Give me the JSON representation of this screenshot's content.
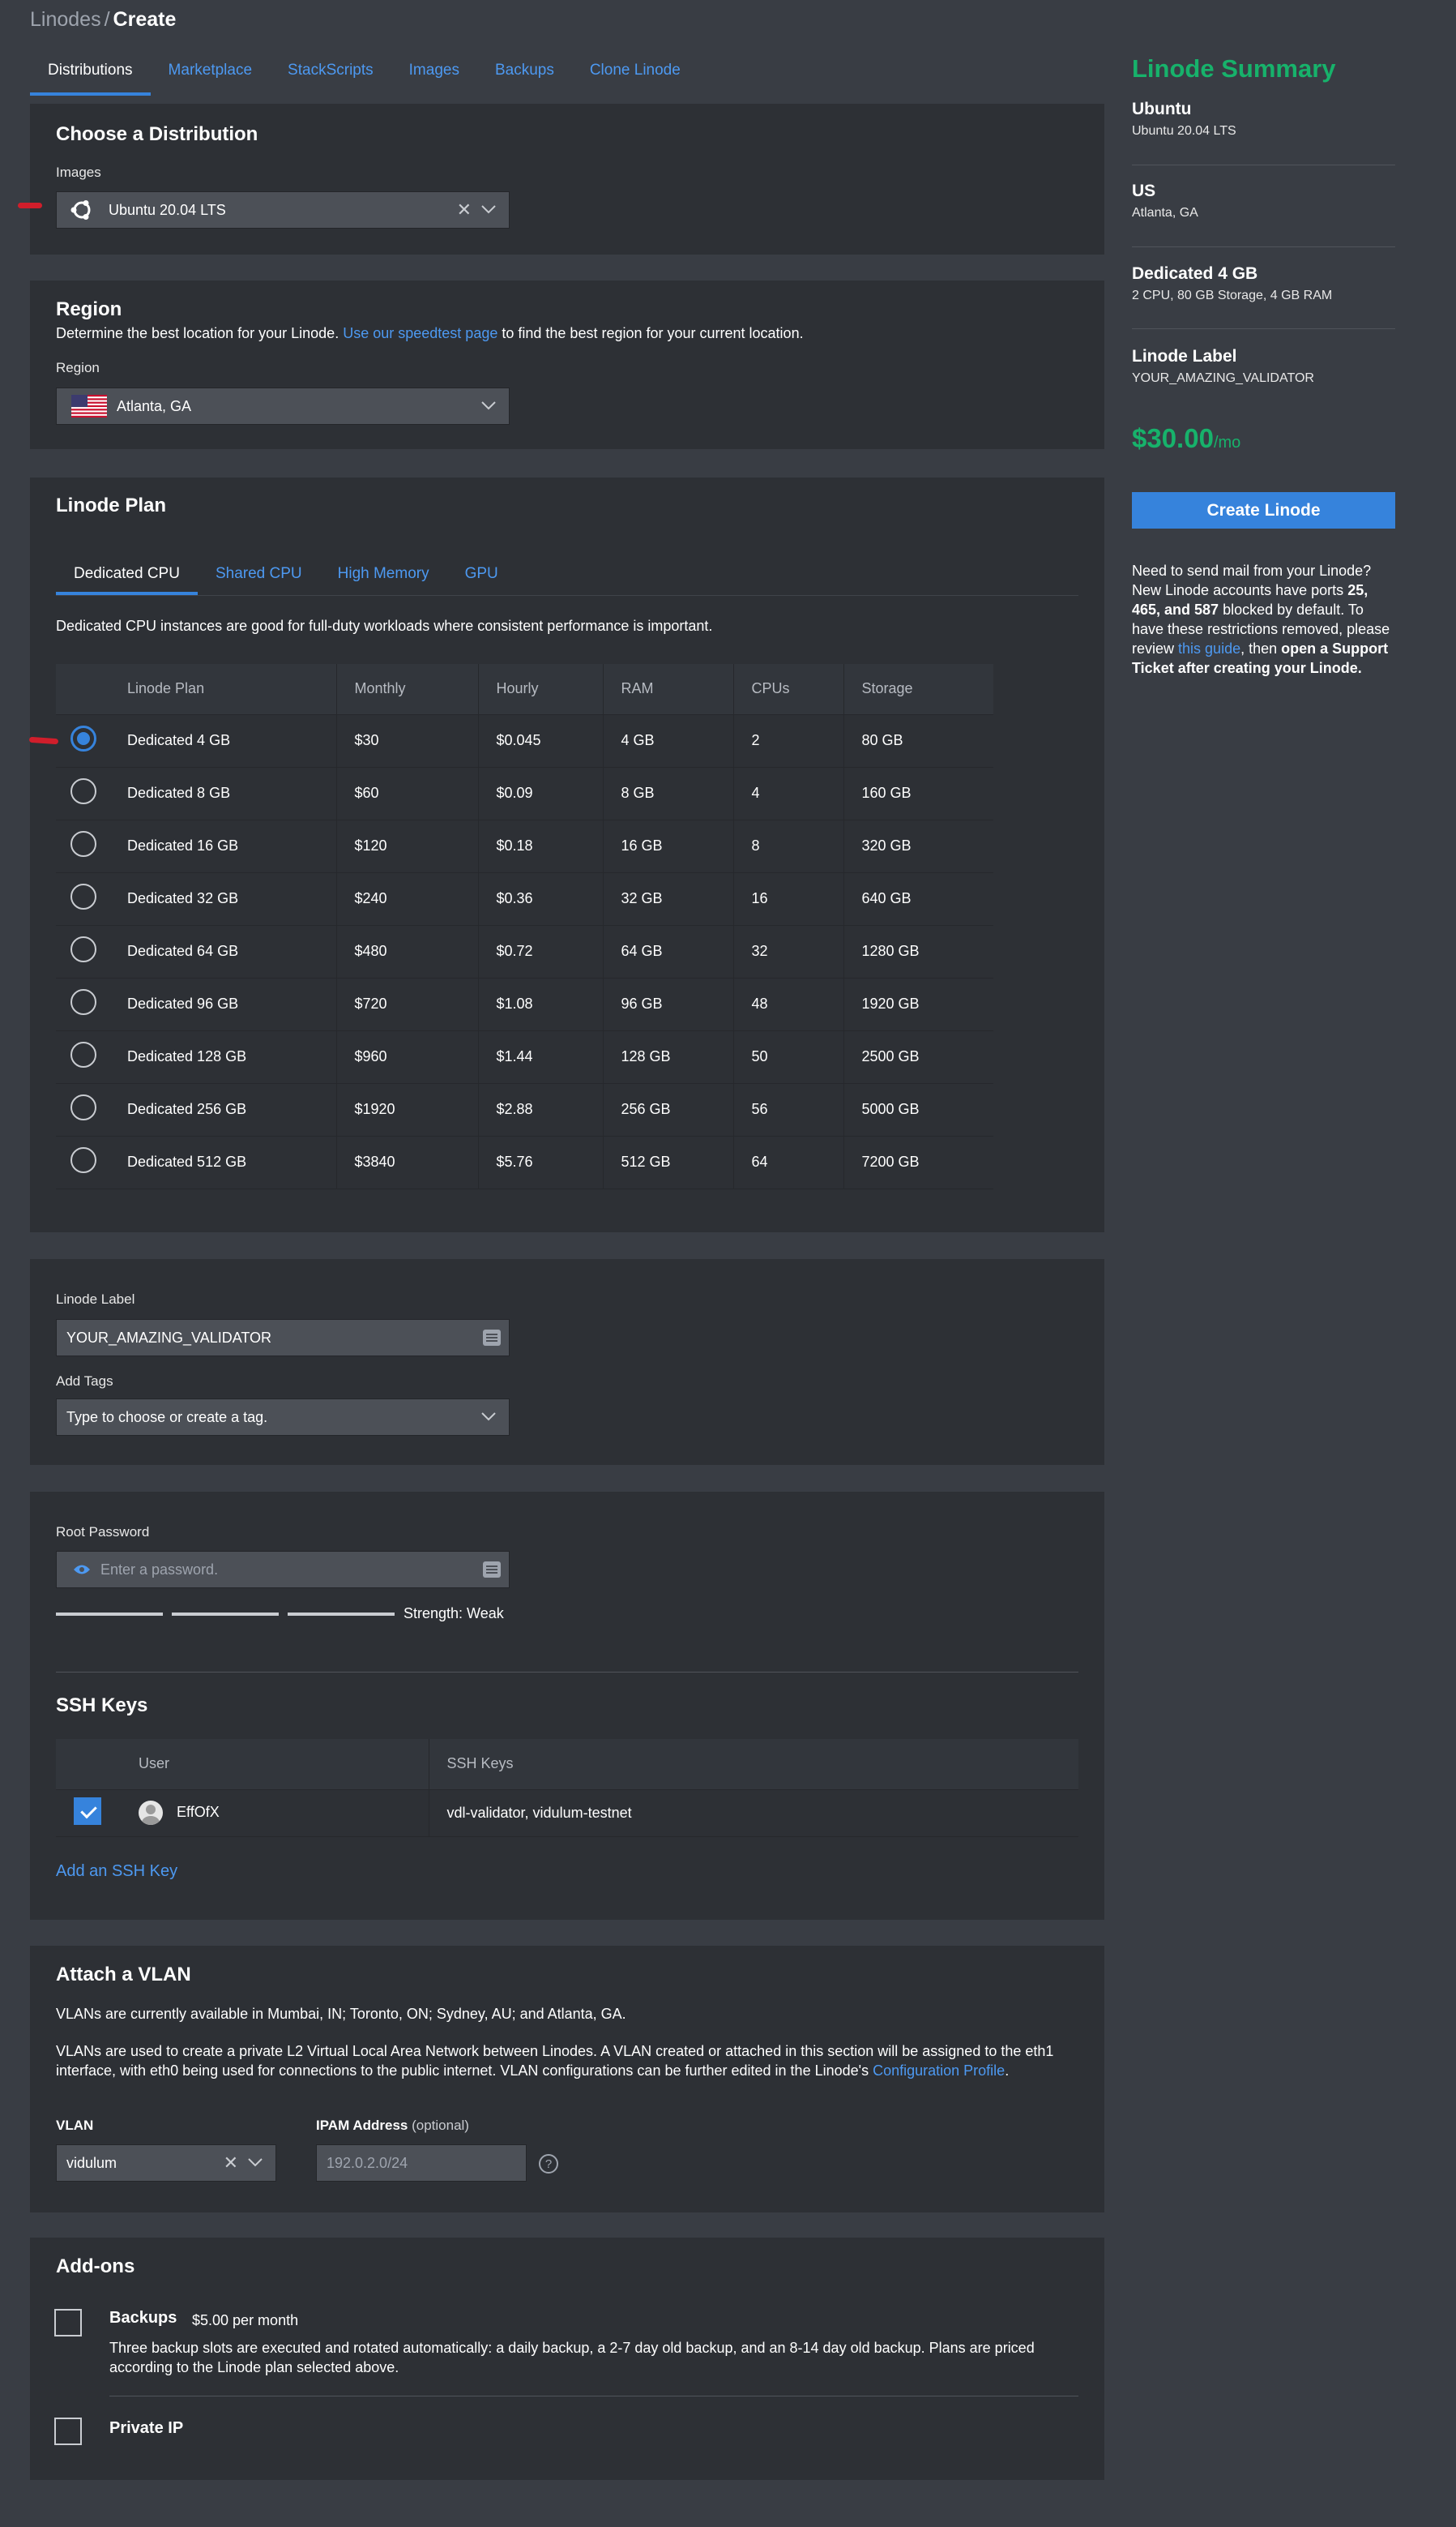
{
  "breadcrumb": {
    "parent": "Linodes",
    "separator": "/",
    "current": "Create"
  },
  "tabs": [
    "Distributions",
    "Marketplace",
    "StackScripts",
    "Images",
    "Backups",
    "Clone Linode"
  ],
  "distribution": {
    "title": "Choose a Distribution",
    "images_label": "Images",
    "selected_image": "Ubuntu 20.04 LTS"
  },
  "region": {
    "title": "Region",
    "description_before": "Determine the best location for your Linode.",
    "description_link": "Use our speedtest page",
    "description_after": "to find the best region for your current location.",
    "label": "Region",
    "selected": "Atlanta, GA"
  },
  "plan": {
    "title": "Linode Plan",
    "tabs": [
      "Dedicated CPU",
      "Shared CPU",
      "High Memory",
      "GPU"
    ],
    "description": "Dedicated CPU instances are good for full-duty workloads where consistent performance is important.",
    "columns": [
      "Linode Plan",
      "Monthly",
      "Hourly",
      "RAM",
      "CPUs",
      "Storage"
    ],
    "rows": [
      {
        "name": "Dedicated 4 GB",
        "monthly": "$30",
        "hourly": "$0.045",
        "ram": "4 GB",
        "cpus": "2",
        "storage": "80 GB",
        "selected": true
      },
      {
        "name": "Dedicated 8 GB",
        "monthly": "$60",
        "hourly": "$0.09",
        "ram": "8 GB",
        "cpus": "4",
        "storage": "160 GB",
        "selected": false
      },
      {
        "name": "Dedicated 16 GB",
        "monthly": "$120",
        "hourly": "$0.18",
        "ram": "16 GB",
        "cpus": "8",
        "storage": "320 GB",
        "selected": false
      },
      {
        "name": "Dedicated 32 GB",
        "monthly": "$240",
        "hourly": "$0.36",
        "ram": "32 GB",
        "cpus": "16",
        "storage": "640 GB",
        "selected": false
      },
      {
        "name": "Dedicated 64 GB",
        "monthly": "$480",
        "hourly": "$0.72",
        "ram": "64 GB",
        "cpus": "32",
        "storage": "1280 GB",
        "selected": false
      },
      {
        "name": "Dedicated 96 GB",
        "monthly": "$720",
        "hourly": "$1.08",
        "ram": "96 GB",
        "cpus": "48",
        "storage": "1920 GB",
        "selected": false
      },
      {
        "name": "Dedicated 128 GB",
        "monthly": "$960",
        "hourly": "$1.44",
        "ram": "128 GB",
        "cpus": "50",
        "storage": "2500 GB",
        "selected": false
      },
      {
        "name": "Dedicated 256 GB",
        "monthly": "$1920",
        "hourly": "$2.88",
        "ram": "256 GB",
        "cpus": "56",
        "storage": "5000 GB",
        "selected": false
      },
      {
        "name": "Dedicated 512 GB",
        "monthly": "$3840",
        "hourly": "$5.76",
        "ram": "512 GB",
        "cpus": "64",
        "storage": "7200 GB",
        "selected": false
      }
    ]
  },
  "label_section": {
    "label": "Linode Label",
    "value": "YOUR_AMAZING_VALIDATOR",
    "tags_label": "Add Tags",
    "tags_placeholder": "Type to choose or create a tag."
  },
  "password": {
    "label": "Root Password",
    "placeholder": "Enter a password.",
    "strength": "Strength: Weak"
  },
  "ssh": {
    "title": "SSH Keys",
    "columns": [
      "User",
      "SSH Keys"
    ],
    "rows": [
      {
        "user": "EffOfX",
        "keys": "vdl-validator, vidulum-testnet",
        "checked": true
      }
    ],
    "add_link": "Add an SSH Key"
  },
  "vlan": {
    "title": "Attach a VLAN",
    "availability": "VLANs are currently available in Mumbai, IN; Toronto, ON; Sydney, AU; and Atlanta, GA.",
    "description": "VLANs are used to create a private L2 Virtual Local Area Network between Linodes. A VLAN created or attached in this section will be assigned to the eth1 interface, with eth0 being used for connections to the public internet. VLAN configurations can be further edited in the Linode's",
    "description_link": "Configuration Profile",
    "description_end": ".",
    "vlan_label": "VLAN",
    "vlan_value": "vidulum",
    "ipam_label": "IPAM Address",
    "ipam_optional": "(optional)",
    "ipam_placeholder": "192.0.2.0/24",
    "help": "?"
  },
  "addons": {
    "title": "Add-ons",
    "backups_label": "Backups",
    "backups_price": "$5.00 per month",
    "backups_description": "Three backup slots are executed and rotated automatically: a daily backup, a 2-7 day old backup, and an 8-14 day old backup. Plans are priced according to the Linode plan selected above.",
    "private_ip_label": "Private IP"
  },
  "summary": {
    "title": "Linode Summary",
    "image_heading": "Ubuntu",
    "image_detail": "Ubuntu 20.04 LTS",
    "region_heading": "US",
    "region_detail": "Atlanta, GA",
    "plan_heading": "Dedicated 4 GB",
    "plan_detail": "2 CPU, 80 GB Storage, 4 GB RAM",
    "label_heading": "Linode Label",
    "label_detail": "YOUR_AMAZING_VALIDATOR",
    "price": "$30.00",
    "price_unit": "/mo",
    "create_button": "Create Linode",
    "mail_1": "Need to send mail from your Linode? New Linode accounts have ports",
    "mail_ports": "25, 465, and 587",
    "mail_2": "blocked by default. To have these restrictions removed, please review",
    "mail_link": "this guide",
    "mail_3": ", then",
    "mail_bold": "open a Support Ticket after creating your Linode."
  },
  "colors": {
    "accent_blue": "#3683dc",
    "link_blue": "#4d99f1",
    "price_green": "#17b26b",
    "card_bg": "#2d3035",
    "page_bg": "#393d44"
  }
}
